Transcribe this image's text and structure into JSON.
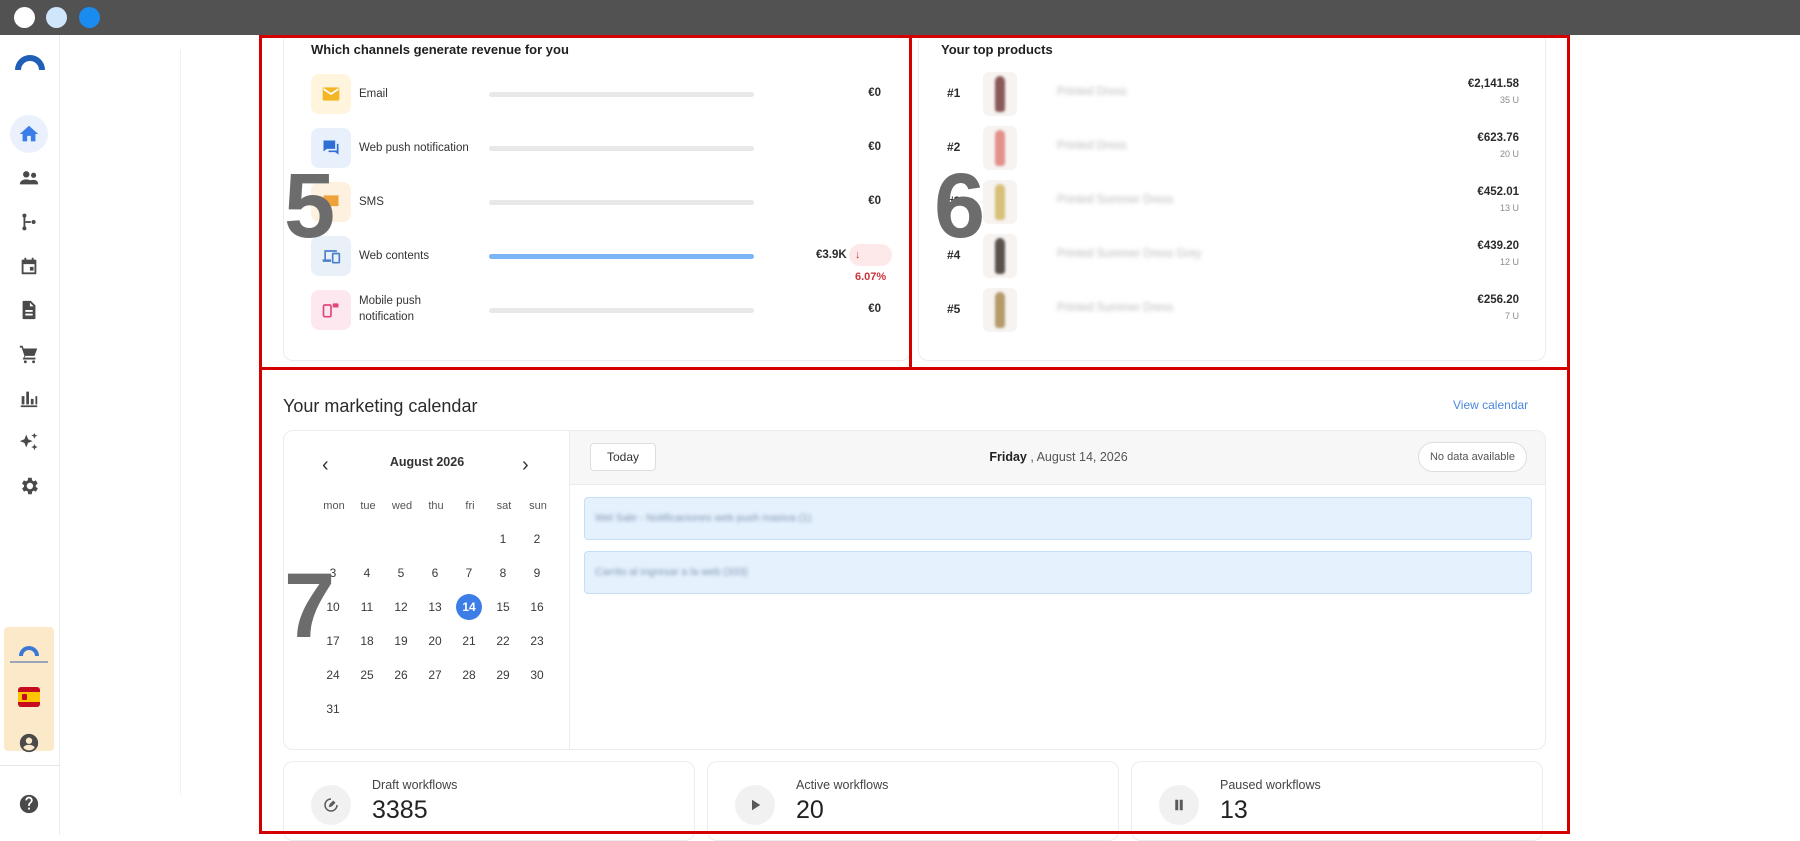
{
  "window": {
    "traffic_lights": [
      "#ffffff",
      "#cfe6fb",
      "#1a8cf0"
    ]
  },
  "sidebar": {
    "items": [
      {
        "icon": "home-icon",
        "active": true
      },
      {
        "icon": "contacts-icon"
      },
      {
        "icon": "workflow-icon"
      },
      {
        "icon": "calendar-icon"
      },
      {
        "icon": "document-icon"
      },
      {
        "icon": "cart-icon"
      },
      {
        "icon": "analytics-icon"
      },
      {
        "icon": "ai-sparkle-icon"
      },
      {
        "icon": "settings-icon"
      }
    ],
    "bottom": [
      "account-icon",
      "help-icon"
    ]
  },
  "annotations": {
    "frame5": "5",
    "frame6": "6",
    "frame7": "7",
    "color": "#d40000"
  },
  "channels": {
    "title": "Which channels generate revenue for you",
    "items": [
      {
        "name": "Email",
        "value": "€0",
        "fill": 0,
        "icon": "email-icon"
      },
      {
        "name": "Web push notification",
        "value": "€0",
        "fill": 0,
        "icon": "chat-icon"
      },
      {
        "name": "SMS",
        "value": "€0",
        "fill": 0,
        "icon": "sms-icon"
      },
      {
        "name": "Web contents",
        "value": "€3.9K",
        "change": "6.07%",
        "fill": 1.0,
        "icon": "devices-icon"
      },
      {
        "name": "Mobile push notification",
        "value": "€0",
        "fill": 0,
        "icon": "mobile-icon"
      }
    ]
  },
  "products": {
    "title": "Your top products",
    "items": [
      {
        "rank": "#1",
        "name": "Printed Dress",
        "price": "€2,141.58",
        "units": "35 U"
      },
      {
        "rank": "#2",
        "name": "Printed Dress",
        "price": "€623.76",
        "units": "20 U"
      },
      {
        "rank": "#3",
        "name": "Printed Summer Dress",
        "price": "€452.01",
        "units": "13 U"
      },
      {
        "rank": "#4",
        "name": "Printed Summer Dress Grey",
        "price": "€439.20",
        "units": "12 U"
      },
      {
        "rank": "#5",
        "name": "Printed Summer Dress",
        "price": "€256.20",
        "units": "7 U"
      }
    ]
  },
  "calendar": {
    "title": "Your marketing calendar",
    "view_link": "View calendar",
    "month": "August 2026",
    "weekdays": [
      "mon",
      "tue",
      "wed",
      "thu",
      "fri",
      "sat",
      "sun"
    ],
    "selected_day": "14",
    "today_button": "Today",
    "day_weekday": "Friday",
    "day_date": ", August 14, 2026",
    "no_data": "No data available",
    "events": [
      "Wel Sale - Notificaciones web push masiva (1)",
      "Carrito al ingresar a la web (333)"
    ]
  },
  "workflows": [
    {
      "label": "Draft workflows",
      "value": "3385",
      "icon": "draft-icon"
    },
    {
      "label": "Active workflows",
      "value": "20",
      "icon": "play-icon"
    },
    {
      "label": "Paused workflows",
      "value": "13",
      "icon": "pause-icon"
    }
  ]
}
